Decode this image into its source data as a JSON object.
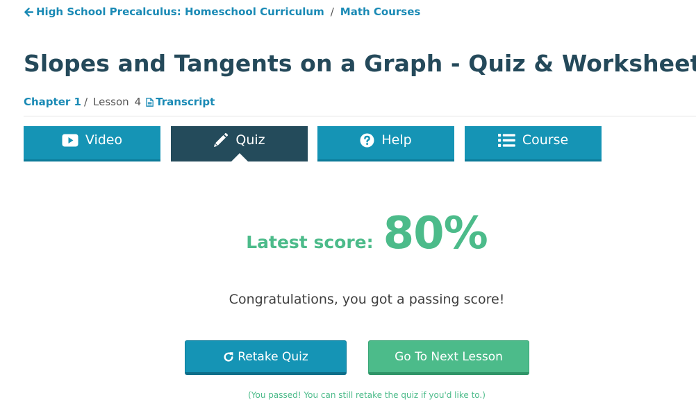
{
  "breadcrumb": {
    "course": "High School Precalculus: Homeschool Curriculum",
    "separator": "/",
    "category": "Math Courses"
  },
  "title": "Slopes and Tangents on a Graph - Quiz & Worksheet",
  "meta": {
    "chapter": "Chapter 1",
    "separator": "/",
    "lesson_label": "Lesson",
    "lesson_number": "4",
    "transcript": "Transcript"
  },
  "tabs": [
    {
      "label": "Video",
      "icon": "video-icon",
      "active": false
    },
    {
      "label": "Quiz",
      "icon": "pencil-icon",
      "active": true
    },
    {
      "label": "Help",
      "icon": "question-circle-icon",
      "active": false
    },
    {
      "label": "Course",
      "icon": "list-icon",
      "active": false
    }
  ],
  "score": {
    "label": "Latest score:",
    "value": "80%"
  },
  "message": "Congratulations, you got a passing score!",
  "buttons": {
    "retake": "Retake Quiz",
    "next": "Go To Next Lesson"
  },
  "note": "(You passed! You can still retake the quiz if you'd like to.)",
  "colors": {
    "link": "#1a8ab5",
    "title": "#24495a",
    "tab": "#1594b5",
    "tab_active": "#244b5b",
    "success": "#4cbb8a"
  }
}
